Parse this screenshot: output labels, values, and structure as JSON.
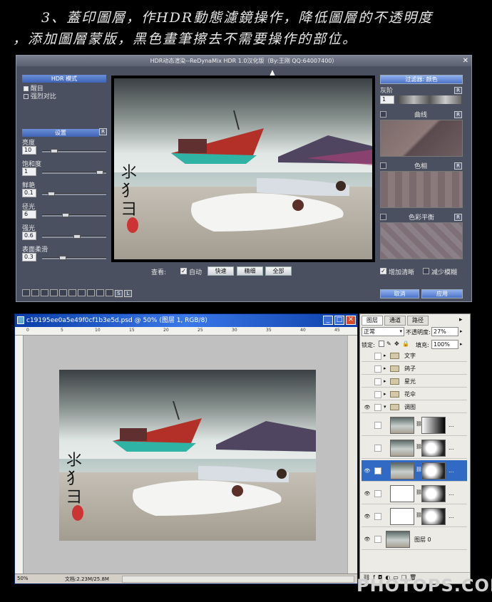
{
  "caption": {
    "line1": "3、蓋印圖層，作HDR動態濾鏡操作，降低圖層的不透明度",
    "line2": "，添加圖層蒙版，黑色畫筆擦去不需要操作的部位。"
  },
  "hdr_dialog": {
    "title": "HDR动态渲染--ReDynaMix HDR 1.0汉化版（By:王刚 QQ:64007400）",
    "close_icon": "close-icon",
    "mode_panel": {
      "header": "HDR 模式",
      "options": [
        "醒目",
        "强烈对比"
      ],
      "selected": "醒目"
    },
    "settings_panel": {
      "header": "设置",
      "reset": "R",
      "params": [
        {
          "label": "亮度",
          "value": "10",
          "level": 0.15
        },
        {
          "label": "饱和度",
          "value": "1",
          "level": 0.95
        },
        {
          "label": "鲜艳",
          "value": "0.1",
          "level": 0.1
        },
        {
          "label": "径光",
          "value": "6",
          "level": 0.35
        },
        {
          "label": "强光",
          "value": "0.6",
          "level": 0.55
        },
        {
          "label": "表面柔滑",
          "value": "0.3",
          "level": 0.3
        }
      ]
    },
    "preview": {
      "label": "查看:",
      "auto_label": "自动",
      "buttons": [
        "快速",
        "精细",
        "全部"
      ]
    },
    "right_panel": {
      "header": "过滤器: 颜色",
      "steps_label": "灰阶",
      "steps_value": "1",
      "sections": [
        "曲线",
        "色相",
        "色彩平衡"
      ],
      "enhance_clarity": "增加清晰",
      "reduce_blur": "减少模糊"
    },
    "footer": {
      "s_btn": "S",
      "l_btn": "L",
      "cancel": "取消",
      "apply": "应用"
    }
  },
  "ps_window": {
    "title": "c19195ee0a5e49f0cf1b3e5d.psd @ 50% (图层 1, RGB/8)",
    "ruler_numbers": [
      "0",
      "5",
      "10",
      "15",
      "20",
      "25",
      "30",
      "35",
      "40",
      "45"
    ],
    "zoom": "50%",
    "doc_info": "文档:2.23M/25.8M"
  },
  "layers_panel": {
    "tabs": [
      "图层",
      "通道",
      "路径"
    ],
    "blend_mode": "正常",
    "opacity_label": "不透明度:",
    "opacity": "27%",
    "lock_label": "锁定:",
    "fill_label": "填充:",
    "fill": "100%",
    "layers": [
      {
        "name": "文字",
        "type": "group",
        "visible": false
      },
      {
        "name": "鸽子",
        "type": "group",
        "visible": false
      },
      {
        "name": "星光",
        "type": "group",
        "visible": false
      },
      {
        "name": "花伞",
        "type": "group",
        "visible": false
      },
      {
        "name": "调图",
        "type": "group",
        "visible": true
      },
      {
        "name": "",
        "type": "layer-mask",
        "visible": false
      },
      {
        "name": "",
        "type": "layer-mask",
        "visible": false
      },
      {
        "name": "",
        "type": "layer-mask",
        "visible": true,
        "selected": true
      },
      {
        "name": "",
        "type": "adjustment",
        "visible": true
      },
      {
        "name": "",
        "type": "adjustment",
        "visible": true
      },
      {
        "name": "图层 0",
        "type": "layer",
        "visible": true
      }
    ],
    "more": "..."
  },
  "watermark": "PHOTOPS.COM",
  "colors": {
    "accent": "#3f63b5",
    "titlebar": "#0a3ea8",
    "selected_layer": "#316ac5"
  }
}
